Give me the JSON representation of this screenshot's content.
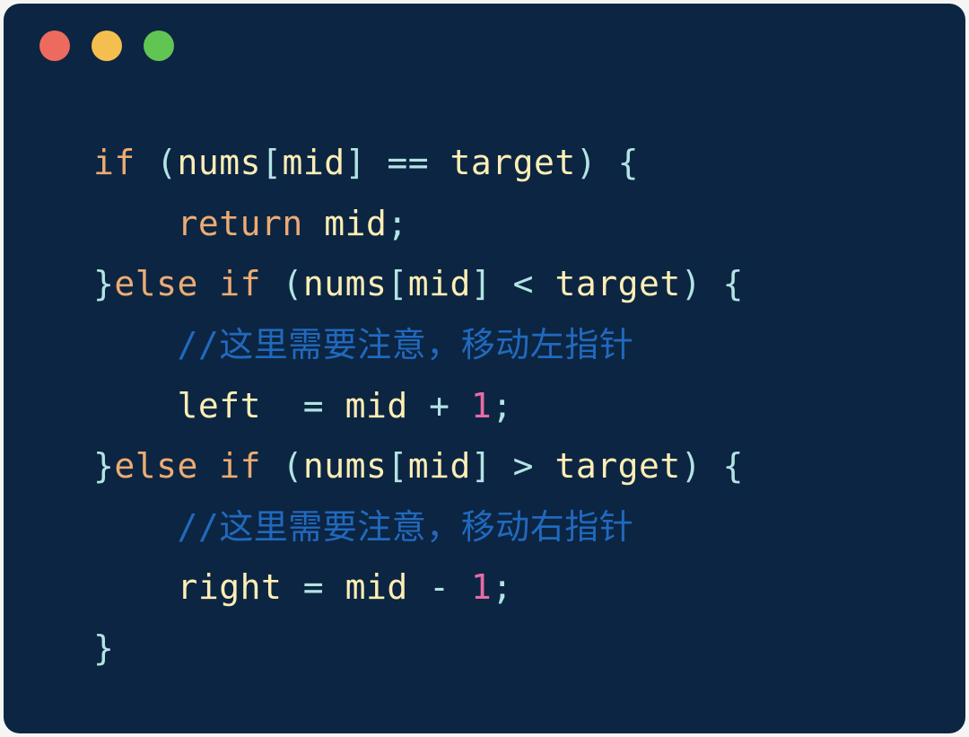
{
  "tokens": {
    "if": "if",
    "else": "else",
    "return": "return",
    "nums": "nums",
    "mid": "mid",
    "target": "target",
    "left": "left",
    "right": "right",
    "eq": "==",
    "lt": "<",
    "gt": ">",
    "assign": "=",
    "plus": "+",
    "minus": "-",
    "semi": ";",
    "lparen": "(",
    "rparen": ")",
    "lbracket": "[",
    "rbracket": "]",
    "lbrace": "{",
    "rbrace": "}",
    "one": "1",
    "commentSlashes": "//",
    "commentLeft": "这里需要注意，移动左指针",
    "commentRight": "这里需要注意，移动右指针"
  }
}
